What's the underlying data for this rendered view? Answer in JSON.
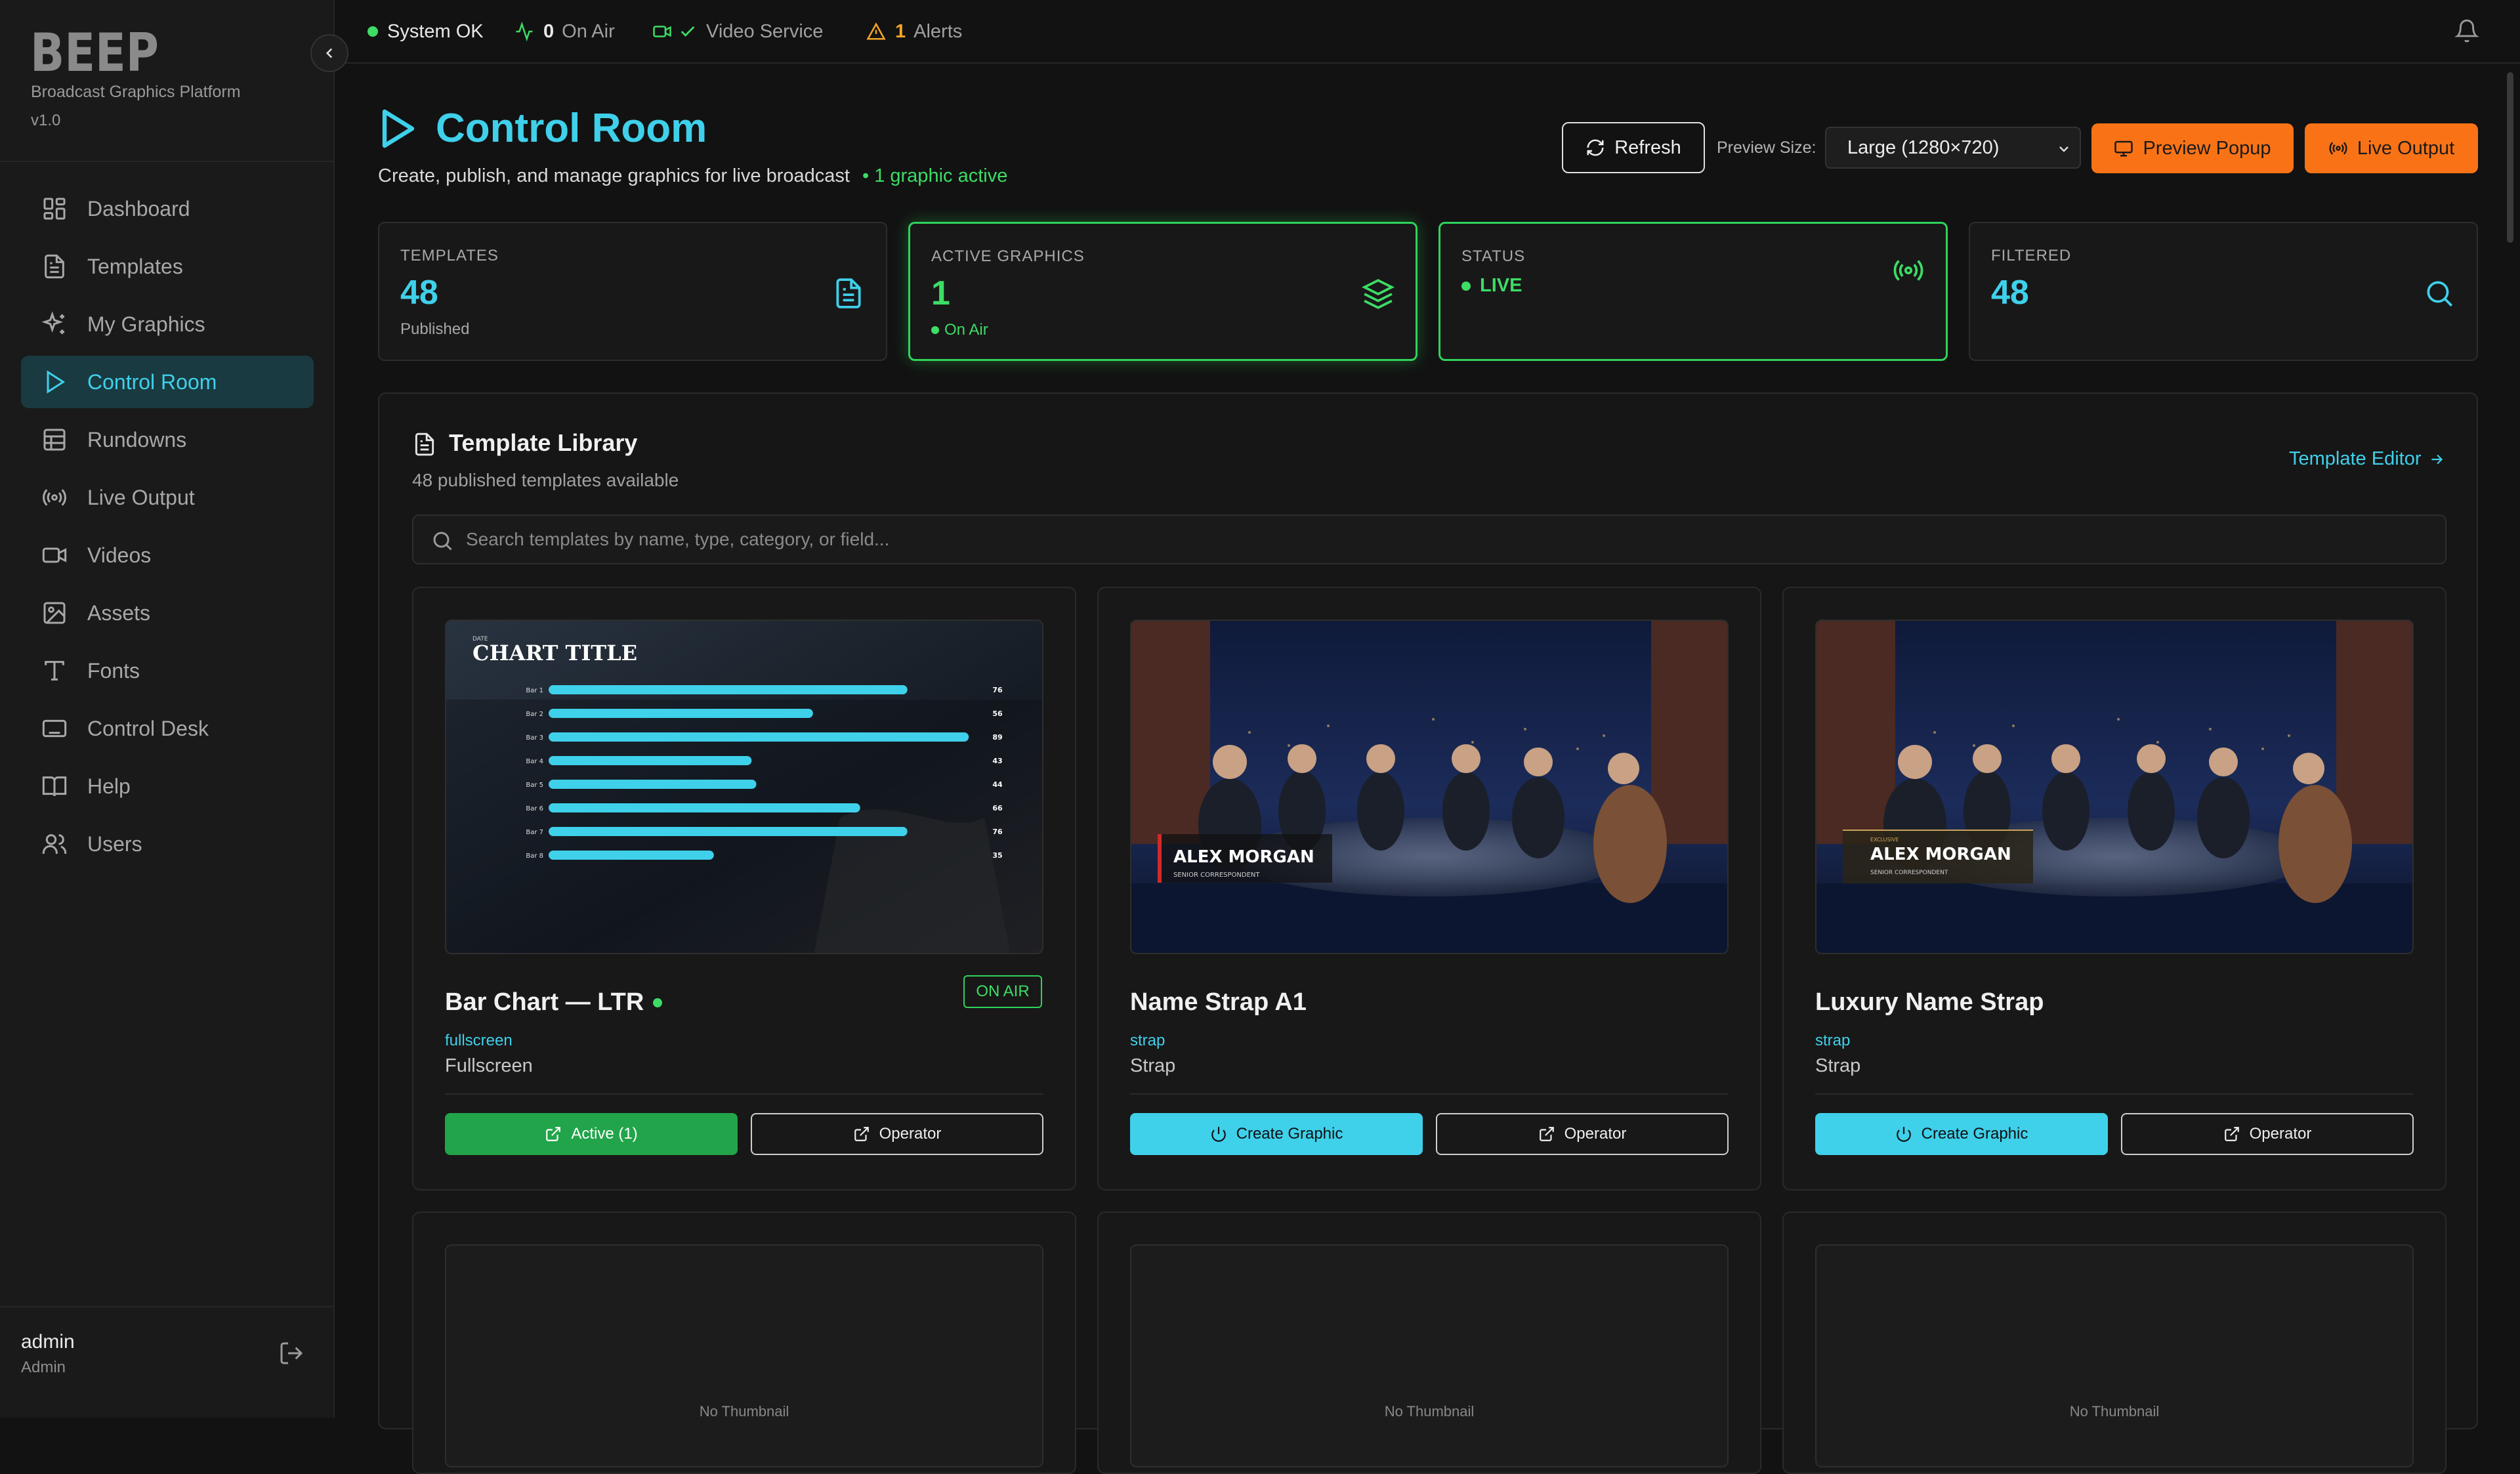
{
  "brand": {
    "logo_text": "BEEP",
    "subtitle": "Broadcast Graphics Platform",
    "version": "v1.0"
  },
  "nav": [
    {
      "label": "Dashboard",
      "icon": "dashboard-icon"
    },
    {
      "label": "Templates",
      "icon": "file-icon"
    },
    {
      "label": "My Graphics",
      "icon": "sparkles-icon"
    },
    {
      "label": "Control Room",
      "icon": "play-icon",
      "active": true
    },
    {
      "label": "Rundowns",
      "icon": "table-icon"
    },
    {
      "label": "Live Output",
      "icon": "broadcast-icon"
    },
    {
      "label": "Videos",
      "icon": "video-icon"
    },
    {
      "label": "Assets",
      "icon": "image-icon"
    },
    {
      "label": "Fonts",
      "icon": "type-icon"
    },
    {
      "label": "Control Desk",
      "icon": "keyboard-icon"
    },
    {
      "label": "Help",
      "icon": "book-icon"
    },
    {
      "label": "Users",
      "icon": "users-icon"
    }
  ],
  "user": {
    "name": "admin",
    "role": "Admin"
  },
  "statusbar": {
    "system": "System OK",
    "on_air_count": "0",
    "on_air_label": "On Air",
    "video_service": "Video Service",
    "alerts_count": "1",
    "alerts_label": "Alerts"
  },
  "header": {
    "title": "Control Room",
    "subtitle": "Create, publish, and manage graphics for live broadcast",
    "active_note": "• 1 graphic active",
    "refresh_label": "Refresh",
    "preview_size_label": "Preview Size:",
    "preview_size_value": "Large (1280×720)",
    "preview_popup_label": "Preview Popup",
    "live_output_label": "Live Output"
  },
  "stats": {
    "templates": {
      "label": "TEMPLATES",
      "value": "48",
      "sub": "Published"
    },
    "active": {
      "label": "ACTIVE GRAPHICS",
      "value": "1",
      "sub": "On Air"
    },
    "status": {
      "label": "STATUS",
      "value": "LIVE"
    },
    "filtered": {
      "label": "FILTERED",
      "value": "48"
    }
  },
  "library": {
    "title": "Template Library",
    "subtitle": "48 published templates available",
    "editor_link": "Template Editor",
    "search_placeholder": "Search templates by name, type, category, or field..."
  },
  "templates": [
    {
      "name": "Bar Chart — LTR",
      "category": "fullscreen",
      "type": "Fullscreen",
      "badge": "ON AIR",
      "primary": "Active (1)",
      "secondary": "Operator"
    },
    {
      "name": "Name Strap A1",
      "category": "strap",
      "type": "Strap",
      "primary": "Create Graphic",
      "secondary": "Operator"
    },
    {
      "name": "Luxury Name Strap",
      "category": "strap",
      "type": "Strap",
      "primary": "Create Graphic",
      "secondary": "Operator"
    }
  ],
  "thumb_chart": {
    "kicker": "DATE",
    "title": "CHART TITLE",
    "bars": [
      {
        "label": "Bar 1",
        "value": 76
      },
      {
        "label": "Bar 2",
        "value": 56
      },
      {
        "label": "Bar 3",
        "value": 89
      },
      {
        "label": "Bar 4",
        "value": 43
      },
      {
        "label": "Bar 5",
        "value": 44
      },
      {
        "label": "Bar 6",
        "value": 66
      },
      {
        "label": "Bar 7",
        "value": 76
      },
      {
        "label": "Bar 8",
        "value": 35
      }
    ]
  },
  "thumb_strap_a": {
    "name": "ALEX MORGAN",
    "role": "SENIOR CORRESPONDENT"
  },
  "thumb_strap_b": {
    "kicker": "EXCLUSIVE",
    "name": "ALEX MORGAN",
    "role": "SENIOR CORRESPONDENT"
  },
  "no_thumbnail": "No Thumbnail",
  "colors": {
    "accent": "#3fd0ea",
    "live": "#3ddc65",
    "orange": "#f97316",
    "bg": "#121212"
  }
}
